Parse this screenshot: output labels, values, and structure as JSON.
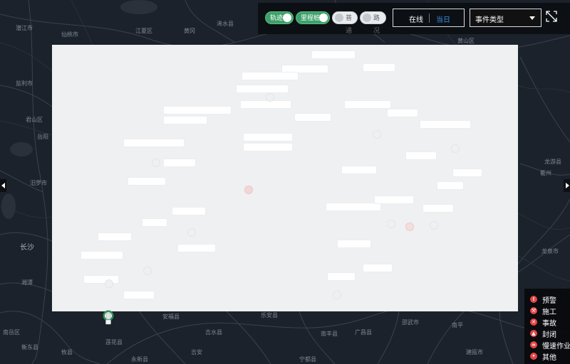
{
  "controls": {
    "toggles": [
      {
        "label": "轨迹",
        "state": "on"
      },
      {
        "label": "里程桩",
        "state": "on"
      },
      {
        "label": "普通",
        "state": "off"
      },
      {
        "label": "路况",
        "state": "off"
      }
    ],
    "segment": {
      "option_a": "在线",
      "option_b": "当日",
      "selected": "当日"
    },
    "event_type_select": {
      "value": "事件类型"
    }
  },
  "legend": {
    "items": [
      {
        "label": "预警",
        "icon": "alert-icon",
        "glyph": "!"
      },
      {
        "label": "施工",
        "icon": "construction-icon",
        "glyph": "⚒"
      },
      {
        "label": "事故",
        "icon": "accident-icon",
        "glyph": "✕"
      },
      {
        "label": "封闭",
        "icon": "closure-icon",
        "glyph": "▲"
      },
      {
        "label": "慢速作业",
        "icon": "slow-work-icon",
        "glyph": "≈"
      },
      {
        "label": "其他",
        "icon": "other-icon",
        "glyph": "•"
      }
    ],
    "color": "#e64545"
  },
  "map": {
    "places": [
      {
        "name": "潜江市",
        "cls": ""
      },
      {
        "name": "仙桃市",
        "cls": ""
      },
      {
        "name": "江夏区",
        "cls": ""
      },
      {
        "name": "黄冈",
        "cls": ""
      },
      {
        "name": "浠水县",
        "cls": ""
      },
      {
        "name": "监利市",
        "cls": ""
      },
      {
        "name": "君山区",
        "cls": ""
      },
      {
        "name": "岳阳",
        "cls": ""
      },
      {
        "name": "汨罗市",
        "cls": ""
      },
      {
        "name": "长沙",
        "cls": "city"
      },
      {
        "name": "湘潭",
        "cls": ""
      },
      {
        "name": "南岳区",
        "cls": ""
      },
      {
        "name": "衡东县",
        "cls": ""
      },
      {
        "name": "攸县",
        "cls": ""
      },
      {
        "name": "莲花县",
        "cls": ""
      },
      {
        "name": "安福县",
        "cls": ""
      },
      {
        "name": "吉水县",
        "cls": ""
      },
      {
        "name": "吉安",
        "cls": ""
      },
      {
        "name": "永新县",
        "cls": ""
      },
      {
        "name": "乐安县",
        "cls": ""
      },
      {
        "name": "南丰县",
        "cls": ""
      },
      {
        "name": "宁都县",
        "cls": ""
      },
      {
        "name": "广昌县",
        "cls": ""
      },
      {
        "name": "邵武市",
        "cls": ""
      },
      {
        "name": "南平",
        "cls": ""
      },
      {
        "name": "建瓯市",
        "cls": ""
      },
      {
        "name": "龙泉市",
        "cls": ""
      },
      {
        "name": "衢州",
        "cls": ""
      },
      {
        "name": "龙游县",
        "cls": ""
      },
      {
        "name": "黄山区",
        "cls": ""
      }
    ]
  }
}
